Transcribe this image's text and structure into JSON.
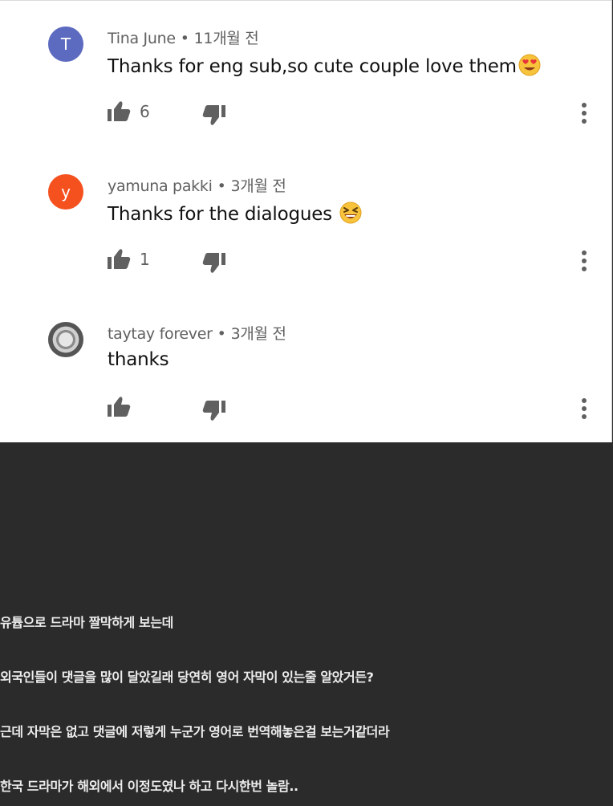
{
  "comments": [
    {
      "avatar_letter": "T",
      "avatar_color": "#5c6bc0",
      "author": "Tina June",
      "separator": "•",
      "time": "11개월 전",
      "text": "Thanks for eng sub,so cute couple love them",
      "emoji": "heart-eyes",
      "like_count": "6"
    },
    {
      "avatar_letter": "y",
      "avatar_color": "#f4511e",
      "author": "yamuna pakki",
      "separator": "•",
      "time": "3개월 전",
      "text": "Thanks for the dialogues ",
      "emoji": "grinning-squinting",
      "like_count": "1"
    },
    {
      "avatar_letter": "",
      "avatar_color": "#555555",
      "author": "taytay forever",
      "separator": "•",
      "time": "3개월 전",
      "text": "thanks",
      "emoji": "",
      "like_count": ""
    }
  ],
  "post": {
    "lines": [
      "유튭으로 드라마 짤막하게 보는데",
      "외국인들이 댓글을 많이 달았길래 당연히 영어 자막이 있는줄 알았거든?",
      "근데 자막은 없고 댓글에 저렇게 누군가 영어로 번역해놓은걸 보는거같더라",
      "한국 드라마가 해외에서 이정도였나 하고 다시한번 놀람.."
    ]
  },
  "colors": {
    "background_dark": "#2b2b2b",
    "panel": "#ffffff",
    "icon": "#606060"
  }
}
